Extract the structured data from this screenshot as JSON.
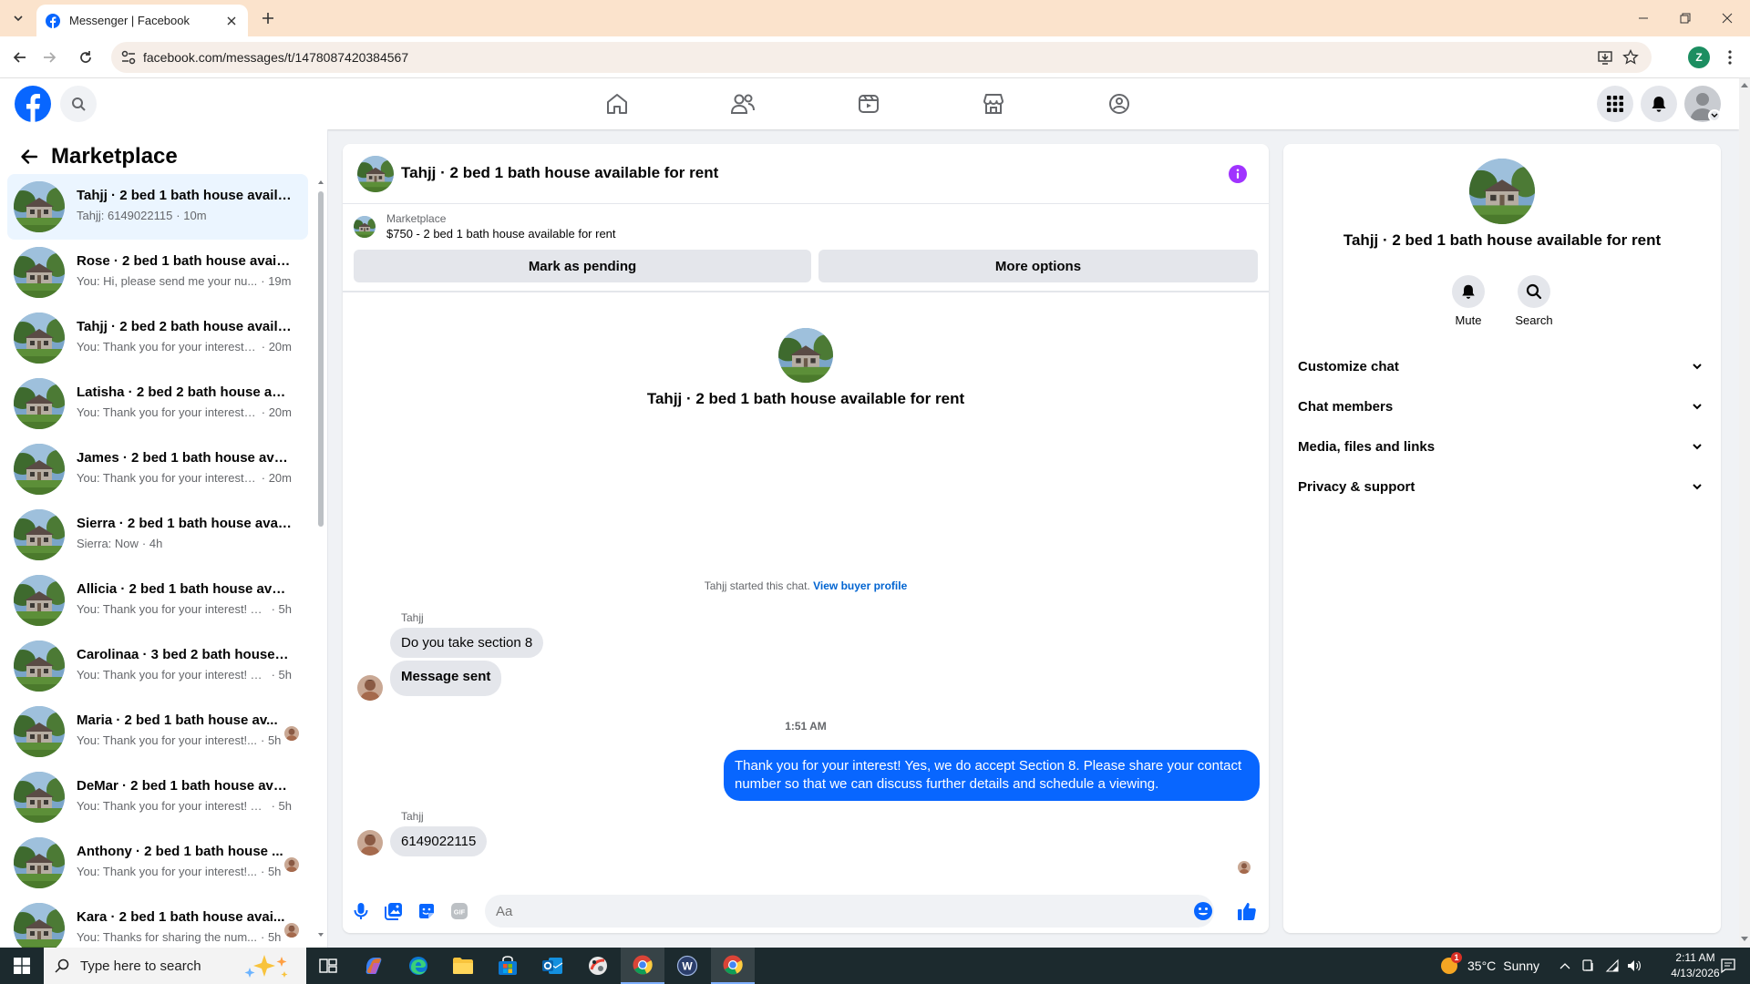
{
  "browser": {
    "tab_title": "Messenger | Facebook",
    "url": "facebook.com/messages/t/1478087420384567",
    "profile_initial": "Z"
  },
  "sidebar": {
    "title": "Marketplace",
    "conversations": [
      {
        "name": "Tahjj · 2 bed 1 bath house availa...",
        "preview": "Tahjj: 6149022115",
        "time": "· 10m",
        "active": true
      },
      {
        "name": "Rose · 2 bed 1 bath house availa...",
        "preview": "You: Hi, please send me your nu...",
        "time": "· 19m"
      },
      {
        "name": "Tahjj · 2 bed 2 bath house availa...",
        "preview": "You: Thank you for your interest! ...",
        "time": "· 20m"
      },
      {
        "name": "Latisha · 2 bed 2 bath house ava...",
        "preview": "You: Thank you for your interest! ...",
        "time": "· 20m"
      },
      {
        "name": "James · 2 bed 1 bath house avail...",
        "preview": "You: Thank you for your interest! ...",
        "time": "· 20m"
      },
      {
        "name": "Sierra · 2 bed 1 bath house avail...",
        "preview": "Sierra: Now",
        "time": "· 4h"
      },
      {
        "name": "Allicia · 2 bed 1 bath house avail...",
        "preview": "You: Thank you for your interest! Ye...",
        "time": "· 5h"
      },
      {
        "name": "Carolinaa · 3 bed 2 bath house a...",
        "preview": "You: Thank you for your interest! Ye...",
        "time": "· 5h"
      },
      {
        "name": "Maria · 2 bed 1 bath house av...",
        "preview": "You: Thank you for your interest!...",
        "time": "· 5h"
      },
      {
        "name": "DeMar · 2 bed 1 bath house avai...",
        "preview": "You: Thank you for your interest! Ye...",
        "time": "· 5h"
      },
      {
        "name": "Anthony · 2 bed 1 bath house ...",
        "preview": "You: Thank you for your interest!...",
        "time": "· 5h"
      },
      {
        "name": "Kara · 2 bed 1 bath house avai...",
        "preview": "You: Thanks for sharing the num...",
        "time": "· 5h"
      }
    ]
  },
  "chat": {
    "title": "Tahjj · 2 bed 1 bath house available for rent",
    "listing_source": "Marketplace",
    "listing_price": "$750 - 2 bed 1 bath house available for rent",
    "mark_pending_label": "Mark as pending",
    "more_options_label": "More options",
    "intro_title": "Tahjj · 2 bed 1 bath house available for rent",
    "started_text": "Tahjj started this chat.",
    "view_buyer_profile": "View buyer profile",
    "sender_name": "Tahjj",
    "msg1": "Do you take section 8",
    "msg2": "Message sent",
    "timestamp": "1:51 AM",
    "outgoing": "Thank you for your interest! Yes, we do accept Section 8. Please share your contact number so that we can discuss further details and schedule a viewing.",
    "sender_name2": "Tahjj",
    "msg3": "6149022115",
    "composer_placeholder": "Aa"
  },
  "details": {
    "title": "Tahjj · 2 bed 1 bath house available for rent",
    "mute_label": "Mute",
    "search_label": "Search",
    "sections": [
      "Customize chat",
      "Chat members",
      "Media, files and links",
      "Privacy & support"
    ]
  },
  "taskbar": {
    "search_placeholder": "Type here to search",
    "weather_temp": "35°C",
    "weather_text": "Sunny",
    "weather_badge": "1",
    "time": "2:11 AM",
    "date": "4/13/2026"
  },
  "colors": {
    "fb_blue": "#0866ff",
    "info_purple": "#a033ff",
    "accent_bubble": "#0866ff"
  }
}
